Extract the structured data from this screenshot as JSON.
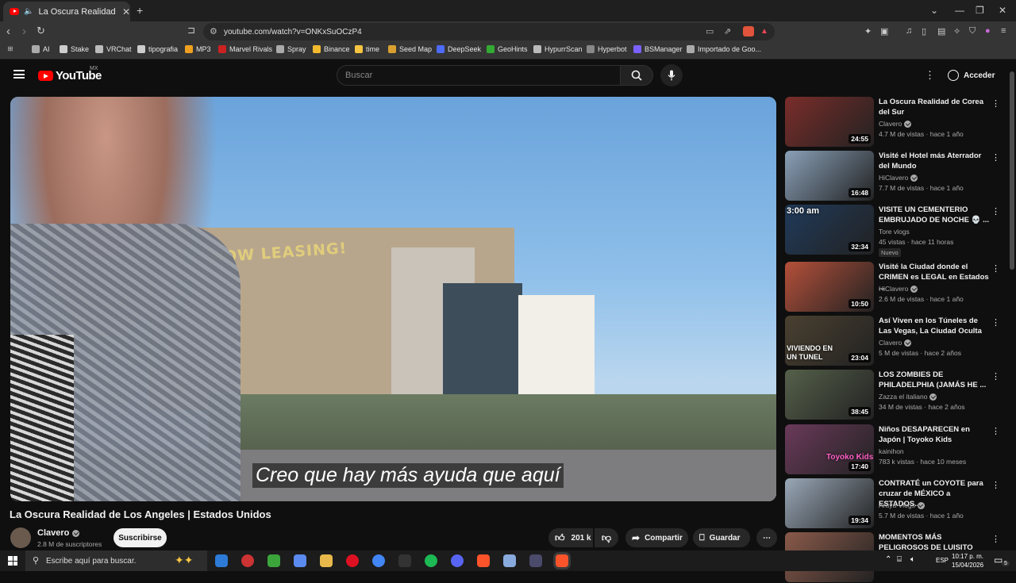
{
  "browser": {
    "tab_title": "La Oscura Realidad de Los Ang",
    "url": "youtube.com/watch?v=ONKxSuOCzP4",
    "bookmarks": [
      {
        "label": "AI",
        "icon": "folder-icon"
      },
      {
        "label": "Stake",
        "icon": "stake-icon"
      },
      {
        "label": "VRChat",
        "icon": "vrchat-icon"
      },
      {
        "label": "tipografia",
        "icon": "type-icon"
      },
      {
        "label": "MP3",
        "icon": "mp3-icon"
      },
      {
        "label": "Marvel Rivals",
        "icon": "marvel-icon"
      },
      {
        "label": "Spray",
        "icon": "spray-icon"
      },
      {
        "label": "Binance",
        "icon": "binance-icon"
      },
      {
        "label": "time",
        "icon": "time-icon"
      },
      {
        "label": "Seed Map",
        "icon": "seed-icon"
      },
      {
        "label": "DeepSeek",
        "icon": "deepseek-icon"
      },
      {
        "label": "GeoHints",
        "icon": "geohints-icon"
      },
      {
        "label": "HypurrScan",
        "icon": "hypurr-icon"
      },
      {
        "label": "Hyperbot",
        "icon": "hyperbot-icon"
      },
      {
        "label": "BSManager",
        "icon": "bsmanager-icon"
      },
      {
        "label": "Importado de Goo...",
        "icon": "folder-icon"
      }
    ]
  },
  "youtube": {
    "logo_text": "YouTube",
    "country_code": "MX",
    "search_placeholder": "Buscar",
    "signin_label": "Acceder"
  },
  "video": {
    "subtitle": "Creo que hay más ayuda que aquí",
    "overlay_sign": "NOW LEASING!",
    "title": "La Oscura Realidad de Los Angeles | Estados Unidos",
    "channel": "Clavero",
    "subscribers": "2.8 M de suscriptores",
    "subscribe_label": "Suscribirse",
    "likes": "201 k",
    "share_label": "Compartir",
    "save_label": "Guardar"
  },
  "recommendations": [
    {
      "title": "La Oscura Realidad de Corea del Sur",
      "channel": "Clavero",
      "verified": true,
      "meta": "4.7 M de vistas · hace 1 año",
      "duration": "24:55",
      "thumb_color": "#7a2d2a"
    },
    {
      "title": "Visité el Hotel más Aterrador del Mundo",
      "channel": "HiClavero",
      "verified": true,
      "meta": "7.7 M de vistas · hace 1 año",
      "duration": "16:48",
      "thumb_color": "#8aa0b8"
    },
    {
      "title": "VISITE UN CEMENTERIO EMBRUJADO DE NOCHE 💀 ...",
      "channel": "Tore vlogs",
      "verified": false,
      "meta": "45 vistas · hace 11 horas",
      "duration": "32:34",
      "thumb_color": "#203a5a",
      "badge": "Nuevo",
      "overlay": "3:00 am"
    },
    {
      "title": "Visité la Ciudad donde el CRIMEN es LEGAL en Estados ...",
      "channel": "HiClavero",
      "verified": true,
      "meta": "2.6 M de vistas · hace 1 año",
      "duration": "10:50",
      "thumb_color": "#b5503a"
    },
    {
      "title": "Así Viven en los Túneles de Las Vegas, La Ciudad Oculta",
      "channel": "Clavero",
      "verified": true,
      "meta": "5 M de vistas · hace 2 años",
      "duration": "23:04",
      "thumb_color": "#4a4030",
      "overlay": "VIVIENDO EN UN TUNEL"
    },
    {
      "title": "LOS ZOMBIES DE PHILADELPHIA (JAMÁS HE ...",
      "channel": "Zazza el italiano",
      "verified": true,
      "meta": "34 M de vistas · hace 2 años",
      "duration": "38:45",
      "thumb_color": "#55604a"
    },
    {
      "title": "Niños DESAPARECEN en Japón | Toyoko Kids",
      "channel": "kainihon",
      "verified": false,
      "meta": "783 k vistas · hace 10 meses",
      "duration": "17:40",
      "thumb_color": "#6a3a5a",
      "overlay": "Toyoko Kids"
    },
    {
      "title": "CONTRATÉ un COYOTE para cruzar de MÉXICO a ESTADOS...",
      "channel": "Araya Vlogs",
      "verified": true,
      "meta": "5.7 M de vistas · hace 1 año",
      "duration": "19:34",
      "thumb_color": "#9aa8b8"
    },
    {
      "title": "MOMENTOS MÁS PELIGROSOS DE LUISITO COMUNICA",
      "channel": "",
      "verified": false,
      "meta": "",
      "duration": "",
      "thumb_color": "#8a5a4a"
    }
  ],
  "taskbar": {
    "search_placeholder": "Escribe aquí para buscar.",
    "language": "ESP",
    "time": "10:17 p. m.",
    "date": "15/04/2026",
    "notification_count": "5"
  }
}
